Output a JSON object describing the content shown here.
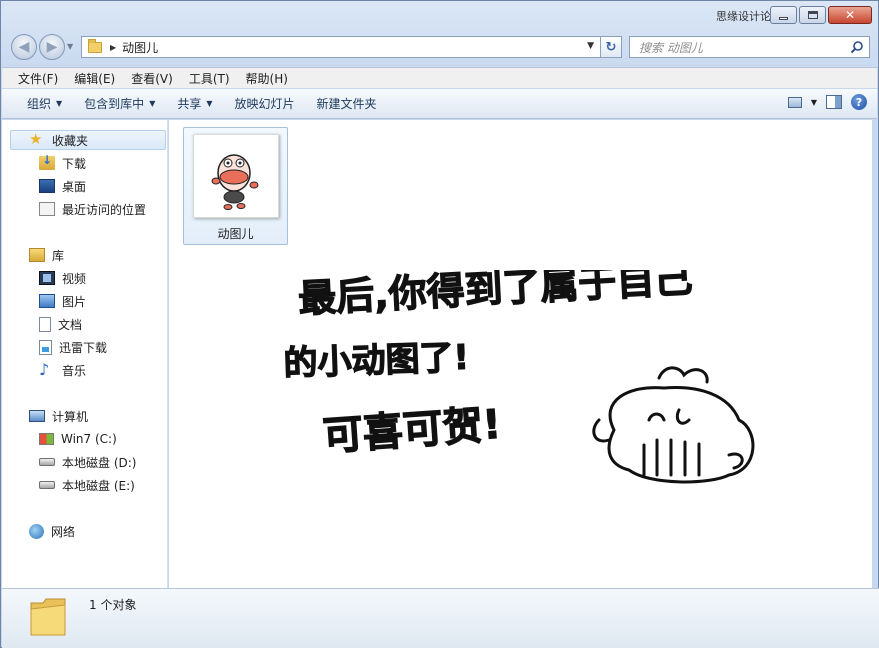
{
  "window": {
    "watermark": "思缘设计论坛"
  },
  "address": {
    "path": "动图儿",
    "search_placeholder": "搜索 动图儿"
  },
  "menu": {
    "items": [
      "文件(F)",
      "编辑(E)",
      "查看(V)",
      "工具(T)",
      "帮助(H)"
    ]
  },
  "commands": {
    "organize": "组织",
    "include": "包含到库中",
    "share": "共享",
    "slideshow": "放映幻灯片",
    "new_folder": "新建文件夹"
  },
  "nav": {
    "favorites": "收藏夹",
    "downloads": "下载",
    "desktop": "桌面",
    "recent": "最近访问的位置",
    "libraries": "库",
    "videos": "视频",
    "pictures": "图片",
    "documents": "文档",
    "thunder": "迅雷下载",
    "music": "音乐",
    "computer": "计算机",
    "drive_c": "Win7 (C:)",
    "drive_d": "本地磁盘 (D:)",
    "drive_e": "本地磁盘 (E:)",
    "network": "网络"
  },
  "content": {
    "file_name": "动图儿",
    "handwriting": {
      "line1": "最后,你得到了属于自己",
      "line2": "的小动图了!",
      "line3": "可喜可贺!"
    }
  },
  "details": {
    "count": "1 个对象"
  }
}
